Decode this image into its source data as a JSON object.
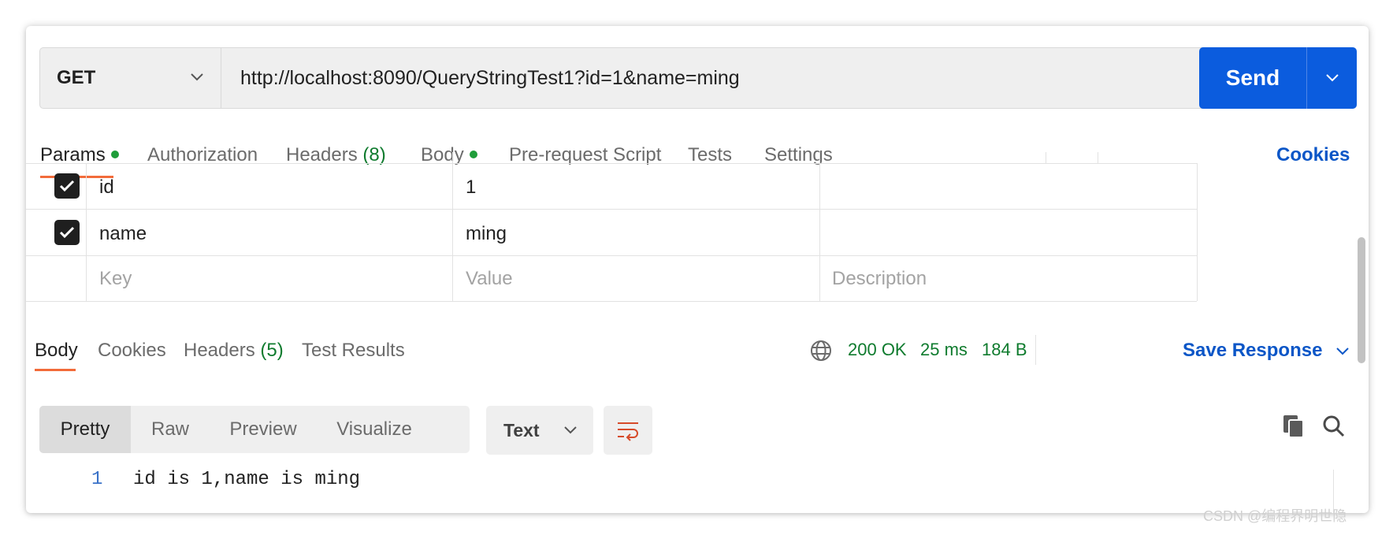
{
  "request": {
    "method": "GET",
    "url": "http://localhost:8090/QueryStringTest1?id=1&name=ming",
    "send_label": "Send"
  },
  "request_tabs": {
    "params": "Params",
    "authorization": "Authorization",
    "headers": "Headers",
    "headers_count": "(8)",
    "body": "Body",
    "pre_request": "Pre-request Script",
    "tests": "Tests",
    "settings": "Settings",
    "cookies": "Cookies"
  },
  "params": {
    "rows": [
      {
        "key": "id",
        "value": "1",
        "description": "",
        "checked": true
      },
      {
        "key": "name",
        "value": "ming",
        "description": "",
        "checked": true
      }
    ],
    "placeholder": {
      "key": "Key",
      "value": "Value",
      "description": "Description"
    }
  },
  "response": {
    "tabs": {
      "body": "Body",
      "cookies": "Cookies",
      "headers": "Headers",
      "headers_count": "(5)",
      "test_results": "Test Results"
    },
    "status": "200 OK",
    "time": "25 ms",
    "size": "184 B",
    "save_response": "Save Response",
    "view_modes": [
      "Pretty",
      "Raw",
      "Preview",
      "Visualize"
    ],
    "format": "Text",
    "lines": [
      {
        "number": "1",
        "text": "id is 1,name is ming"
      }
    ]
  },
  "watermark": "CSDN @编程界明世隐",
  "colors": {
    "accent_blue": "#0b5cde",
    "link_blue": "#0b56c7",
    "success_green": "#0f7b2e",
    "tab_underline": "#f26b3a"
  }
}
